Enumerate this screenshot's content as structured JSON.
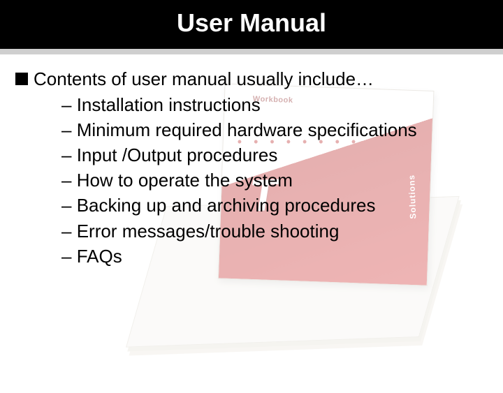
{
  "title": "User Manual",
  "lead": "Contents of user manual usually include…",
  "items": [
    "Installation instructions",
    "Minimum required hardware specifications",
    "Input /Output procedures",
    "How to operate the system",
    "Backing up and archiving procedures",
    "Error messages/trouble shooting",
    "FAQs"
  ],
  "book": {
    "topLabel": "Workbook",
    "big": "T",
    "side": "Solutions"
  }
}
